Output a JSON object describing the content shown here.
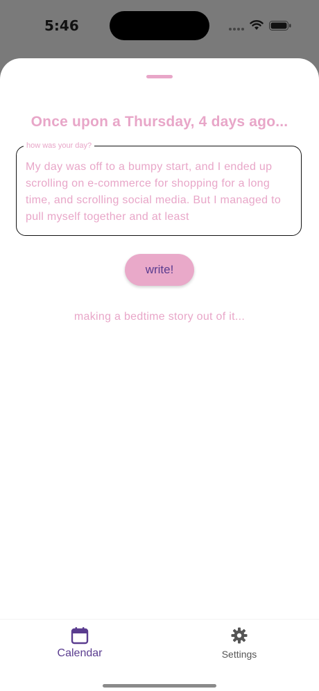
{
  "status_bar": {
    "time": "5:46"
  },
  "sheet": {
    "title": "Once upon a Thursday, 4 days ago...",
    "diary": {
      "label": "how was your day?",
      "value": "My day was off to a bumpy start, and I ended up scrolling on e-commerce for shopping for a long time, and scrolling social media. But I managed to pull myself together and at least"
    },
    "write_label": "write!",
    "status_text": "making a bedtime story out of it..."
  },
  "tab_bar": {
    "tabs": [
      {
        "label": "Calendar",
        "icon": "calendar-icon",
        "selected": true
      },
      {
        "label": "Settings",
        "icon": "gear-icon",
        "selected": false
      }
    ]
  },
  "colors": {
    "accent_pink": "#e8a6c8",
    "accent_purple": "#5a3c8f",
    "backdrop": "#7a7a7a"
  }
}
